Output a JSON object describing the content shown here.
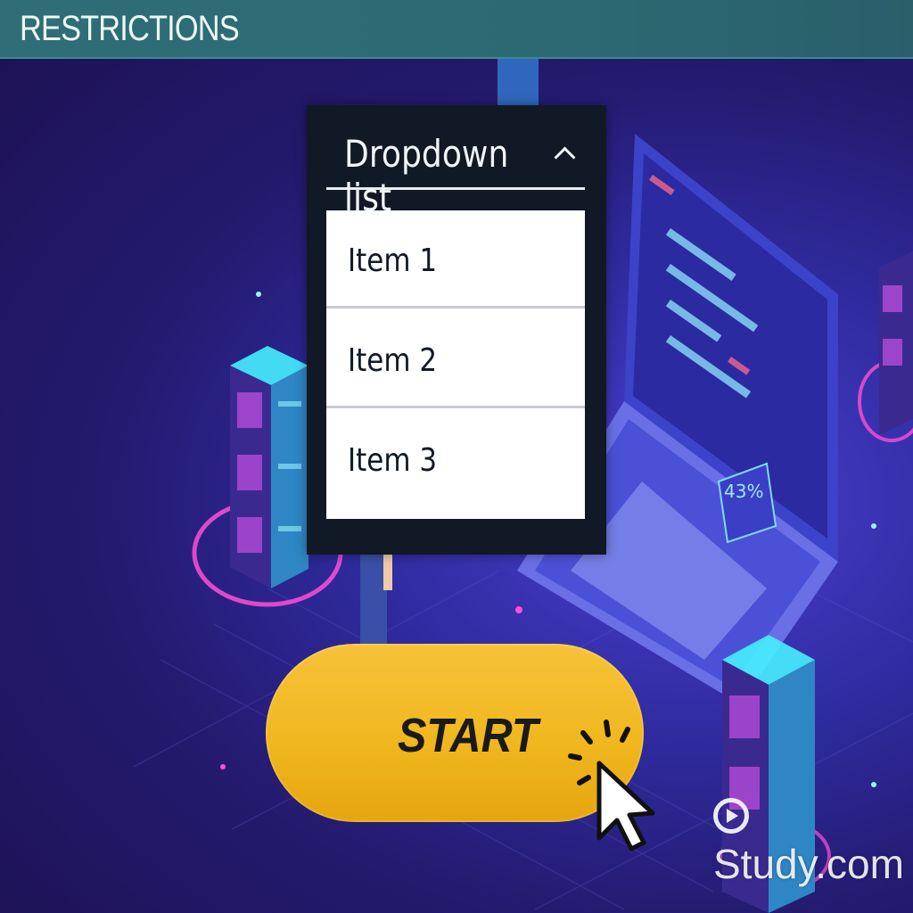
{
  "header": {
    "title": "RESTRICTIONS"
  },
  "dropdown": {
    "title": "Dropdown list",
    "caret_icon": "chevron-up-icon",
    "items": [
      {
        "label": "Item 1"
      },
      {
        "label": "Item 2"
      },
      {
        "label": "Item 3"
      }
    ]
  },
  "start_button": {
    "label": "START",
    "cursor_icon": "pointer-cursor-icon"
  },
  "watermark": {
    "text": "Study.com",
    "logo_icon": "play-circle-icon"
  },
  "laptop_screen": {
    "percent_label": "43%"
  },
  "colors": {
    "header_bar": "#2f6e77",
    "dropdown_bg": "#111826",
    "start_button": "#f0b71e",
    "background": "#2e2a9c",
    "neon_pink": "#ff4fd8",
    "neon_cyan": "#36e0ff"
  }
}
